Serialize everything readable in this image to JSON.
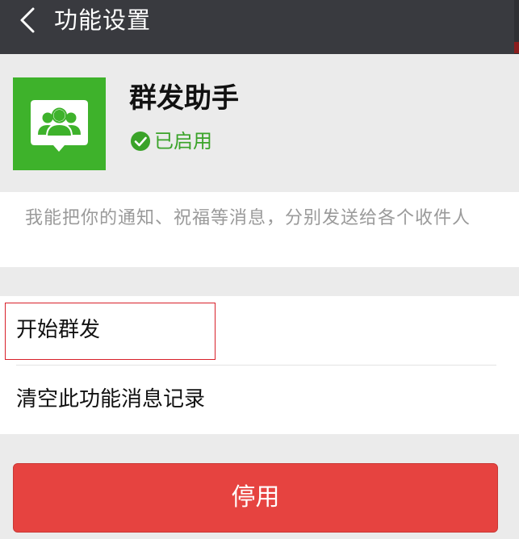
{
  "topbar": {
    "title": "功能设置",
    "back_icon": "chevron-left-icon"
  },
  "feature": {
    "name": "群发助手",
    "icon": "group-chat-icon",
    "icon_color": "#3eb22b",
    "status": {
      "icon": "check-circle-icon",
      "text": "已启用",
      "color": "#3aa329"
    },
    "description": "我能把你的通知、祝福等消息，分别发送给各个收件人"
  },
  "menu": {
    "items": [
      {
        "label": "开始群发",
        "highlighted": true
      },
      {
        "label": "清空此功能消息记录",
        "highlighted": false
      }
    ]
  },
  "actions": {
    "disable_label": "停用",
    "disable_color": "#e64340"
  }
}
